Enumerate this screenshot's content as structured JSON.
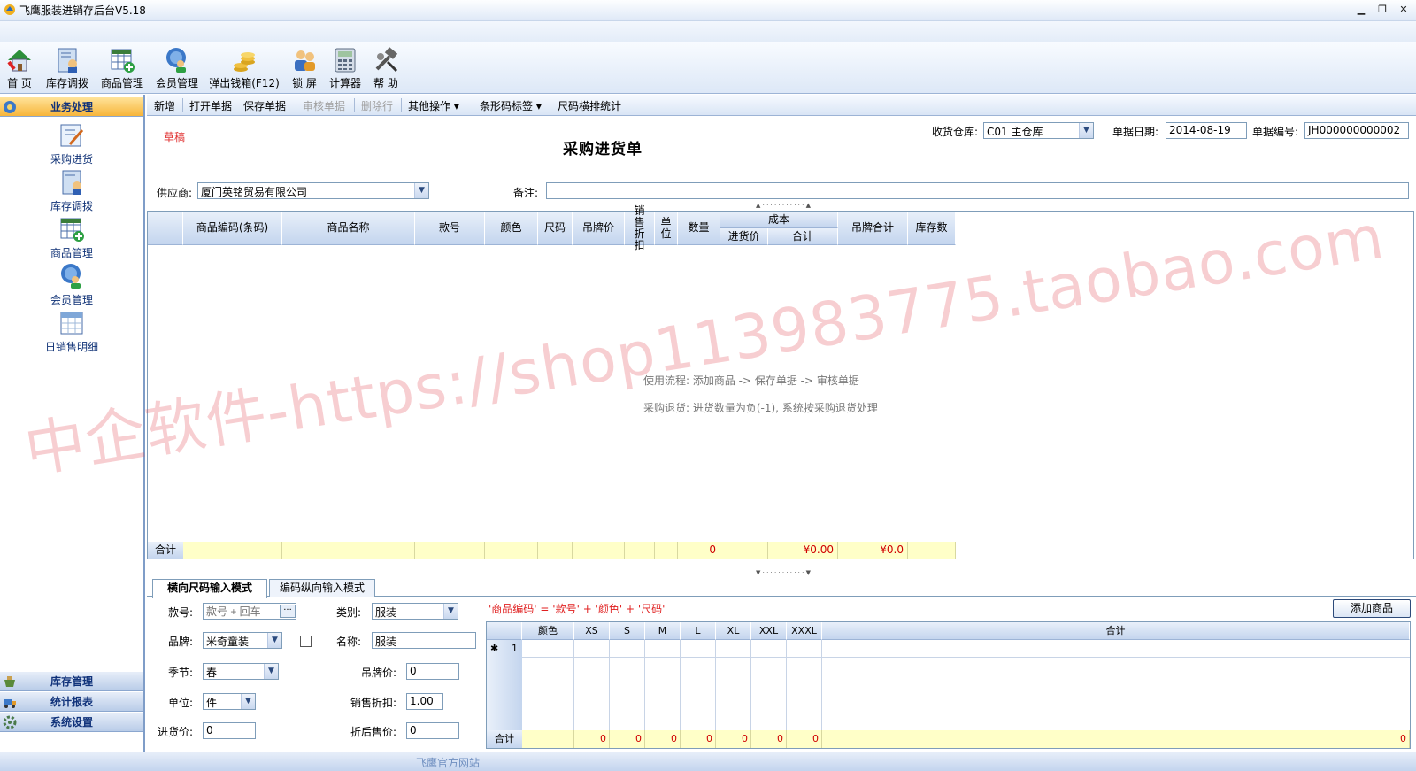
{
  "window": {
    "title": "飞鹰服装进销存后台V5.18"
  },
  "toolbar": [
    {
      "label": "首 页",
      "icon": "home-icon"
    },
    {
      "label": "库存调拨",
      "icon": "inventory-transfer-icon"
    },
    {
      "label": "商品管理",
      "icon": "product-grid-icon"
    },
    {
      "label": "会员管理",
      "icon": "member-icon"
    },
    {
      "label": "弹出钱箱(F12)",
      "icon": "cash-drawer-icon"
    },
    {
      "label": "锁 屏",
      "icon": "lock-screen-icon"
    },
    {
      "label": "计算器",
      "icon": "calculator-icon"
    },
    {
      "label": "帮 助",
      "icon": "help-icon"
    }
  ],
  "sidebar": {
    "active_group": "业务处理",
    "items": [
      "采购进货",
      "库存调拨",
      "商品管理",
      "会员管理",
      "日销售明细"
    ],
    "bottom_groups": [
      "库存管理",
      "统计报表",
      "系统设置"
    ]
  },
  "commands": [
    {
      "label": "新增",
      "enabled": true
    },
    {
      "label": "打开单据",
      "enabled": true
    },
    {
      "label": "保存单据",
      "enabled": true
    },
    {
      "label": "审核单据",
      "enabled": false
    },
    {
      "label": "删除行",
      "enabled": false
    },
    {
      "label": "其他操作 ▾",
      "enabled": true
    },
    {
      "label": "条形码标签 ▾",
      "enabled": true
    },
    {
      "label": "尺码横排统计",
      "enabled": true
    }
  ],
  "form": {
    "status": "草稿",
    "title": "采购进货单",
    "warehouse_label": "收货仓库:",
    "warehouse_value": "C01 主仓库",
    "date_label": "单据日期:",
    "date_value": "2014-08-19",
    "number_label": "单据编号:",
    "number_value": "JH000000000002",
    "supplier_label": "供应商:",
    "supplier_value": "厦门英铭贸易有限公司",
    "note_label": "备注:",
    "note_value": ""
  },
  "grid": {
    "columns": [
      "",
      "商品编码(条码)",
      "商品名称",
      "款号",
      "颜色",
      "尺码",
      "吊牌价",
      "销售折扣",
      "单位",
      "数量",
      "成本",
      "进货价",
      "合计",
      "吊牌合计",
      "库存数"
    ],
    "total_label": "合计",
    "total_qty": "0",
    "total_cost": "¥0.00",
    "total_tag": "¥0.0",
    "hint1": "使用流程: 添加商品 -> 保存单据 -> 审核单据",
    "hint2": "采购退货: 进货数量为负(-1), 系统按采购退货处理"
  },
  "tabs": [
    "横向尺码输入模式",
    "编码纵向输入模式"
  ],
  "entry": {
    "style_label": "款号:",
    "style_placeholder": "款号 + 回车",
    "category_label": "类别:",
    "category_value": "服装",
    "brand_label": "品牌:",
    "brand_value": "米奇童装",
    "name_label": "名称:",
    "name_value": "服装",
    "season_label": "季节:",
    "season_value": "春",
    "tagprice_label": "吊牌价:",
    "tagprice_value": "0",
    "unit_label": "单位:",
    "unit_value": "件",
    "discount_label": "销售折扣:",
    "discount_value": "1.00",
    "cost_label": "进货价:",
    "cost_value": "0",
    "saleprice_label": "折后售价:",
    "saleprice_value": "0",
    "formula": "'商品编码' = '款号' + '颜色' + '尺码'",
    "add_button": "添加商品"
  },
  "size_grid": {
    "columns": [
      "颜色",
      "XS",
      "S",
      "M",
      "L",
      "XL",
      "XXL",
      "XXXL",
      "合计"
    ],
    "row_marker": "✱",
    "row_number": "1",
    "total_label": "合计",
    "totals": [
      "0",
      "0",
      "0",
      "0",
      "0",
      "0",
      "0",
      "0"
    ]
  },
  "statusbar": {
    "link": "飞鹰官方网站"
  },
  "watermark": "中企软件-https://shop113983775.taobao.com"
}
